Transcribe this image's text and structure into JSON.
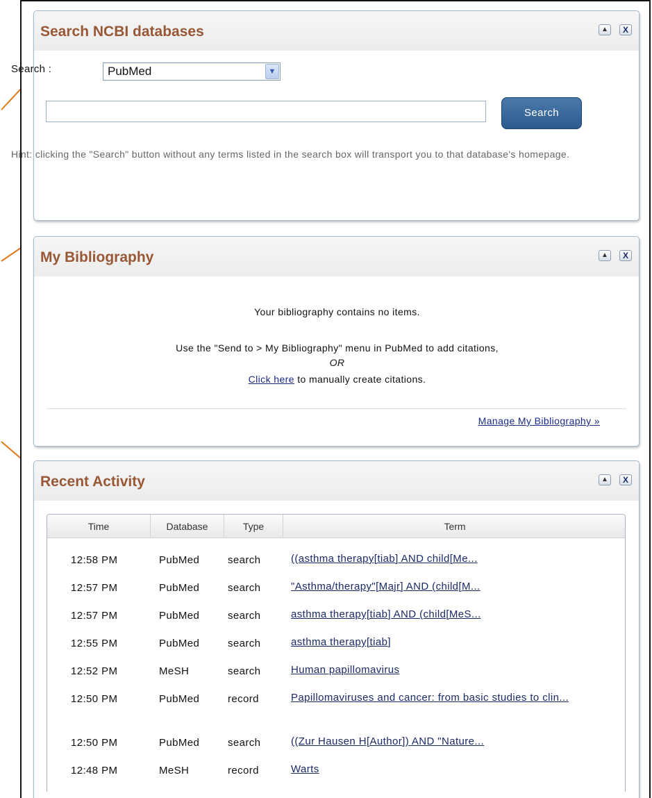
{
  "search_panel": {
    "title": "Search NCBI databases",
    "search_label": "Search :",
    "database_selected": "PubMed",
    "search_input_value": "",
    "search_button": "Search",
    "hint": "Hint: clicking the \"Search\" button without any terms listed in the search box will transport you to that database's homepage."
  },
  "bibliography_panel": {
    "title": "My Bibliography",
    "empty_message": "Your bibliography contains no items.",
    "instruction": "Use the \"Send to > My Bibliography\" menu in PubMed to add citations,",
    "or_text": "OR",
    "click_here_link": "Click here",
    "click_here_suffix": " to manually create citations.",
    "manage_link": "Manage My Bibliography »"
  },
  "activity_panel": {
    "title": "Recent Activity",
    "columns": [
      "Time",
      "Database",
      "Type",
      "Term"
    ],
    "rows": [
      {
        "time": "12:58 PM",
        "database": "PubMed",
        "type": "search",
        "term": "((asthma therapy[tiab] AND child[Me..."
      },
      {
        "time": "12:57 PM",
        "database": "PubMed",
        "type": "search",
        "term": "\"Asthma/therapy\"[Majr] AND (child[M..."
      },
      {
        "time": "12:57 PM",
        "database": "PubMed",
        "type": "search",
        "term": "asthma therapy[tiab] AND (child[MeS..."
      },
      {
        "time": "12:55 PM",
        "database": "PubMed",
        "type": "search",
        "term": "asthma therapy[tiab]"
      },
      {
        "time": "12:52 PM",
        "database": "MeSH",
        "type": "search",
        "term": "Human papillomavirus"
      },
      {
        "time": "12:50 PM",
        "database": "PubMed",
        "type": "record",
        "term": "Papillomaviruses and cancer: from basic studies to clin..."
      },
      {
        "time": "12:50 PM",
        "database": "PubMed",
        "type": "search",
        "term": "((Zur Hausen H[Author]) AND \"Nature..."
      },
      {
        "time": "12:48 PM",
        "database": "MeSH",
        "type": "record",
        "term": "Warts"
      }
    ]
  },
  "controls": {
    "collapse_icon": "▲",
    "close_icon": "X",
    "dropdown_icon": "▼"
  },
  "colors": {
    "title_brown": "#985735",
    "link_blue": "#1a2a88",
    "button_blue": "#2b5a8c",
    "arrow_orange": "#e07818"
  }
}
